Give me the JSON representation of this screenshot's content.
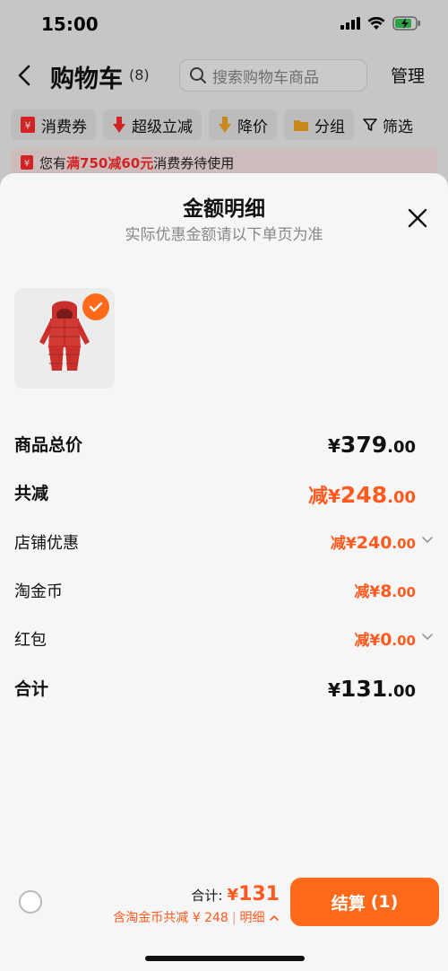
{
  "status_bar": {
    "time": "15:00"
  },
  "header": {
    "title": "购物车",
    "count": "(8)",
    "search_placeholder": "搜索购物车商品",
    "manage_label": "管理"
  },
  "filter_chips": [
    {
      "label": "消费券",
      "icon": "coupon-icon",
      "color": "#ff2b2b"
    },
    {
      "label": "超级立减",
      "icon": "down-arrow-icon",
      "color": "#ff2b2b"
    },
    {
      "label": "降价",
      "icon": "price-drop-icon",
      "color": "#f5a623"
    },
    {
      "label": "分组",
      "icon": "folder-icon",
      "color": "#f5a623"
    },
    {
      "label": "筛选",
      "icon": "filter-icon",
      "color": "#111111"
    }
  ],
  "coupon_notice": {
    "prefix": "您有",
    "highlight": "满750减60元",
    "suffix": "消费券待使用"
  },
  "sheet": {
    "title": "金额明细",
    "subtitle": "实际优惠金额请以下单页为准",
    "product": {
      "image": "red-snowsuit-image",
      "selected": true
    },
    "rows": [
      {
        "label": "商品总价",
        "prefix": "",
        "currency": "¥",
        "integer": "379",
        "decimal": ".00",
        "chevron": false
      },
      {
        "label": "共减",
        "prefix": "减",
        "currency": "¥",
        "integer": "248",
        "decimal": ".00",
        "chevron": false
      },
      {
        "label": "店铺优惠",
        "prefix": "减",
        "currency": "¥",
        "integer": "240",
        "decimal": ".00",
        "chevron": true
      },
      {
        "label": "淘金币",
        "prefix": "减",
        "currency": "¥",
        "integer": "8",
        "decimal": ".00",
        "chevron": false
      },
      {
        "label": "红包",
        "prefix": "减",
        "currency": "¥",
        "integer": "0",
        "decimal": ".00",
        "chevron": true
      },
      {
        "label": "合计",
        "prefix": "",
        "currency": "¥",
        "integer": "131",
        "decimal": ".00",
        "chevron": false
      }
    ]
  },
  "checkout_bar": {
    "total_label": "合计:",
    "total_currency": "¥",
    "total_amount": "131",
    "discount_text": "含淘金币共减 ¥ 248",
    "details_label": "明细",
    "checkout_label": "结算",
    "checkout_count": "(1)"
  },
  "colors": {
    "accent": "#ff6a1a",
    "discount": "#ff5a1f",
    "coupon_red": "#ff2b2b"
  }
}
